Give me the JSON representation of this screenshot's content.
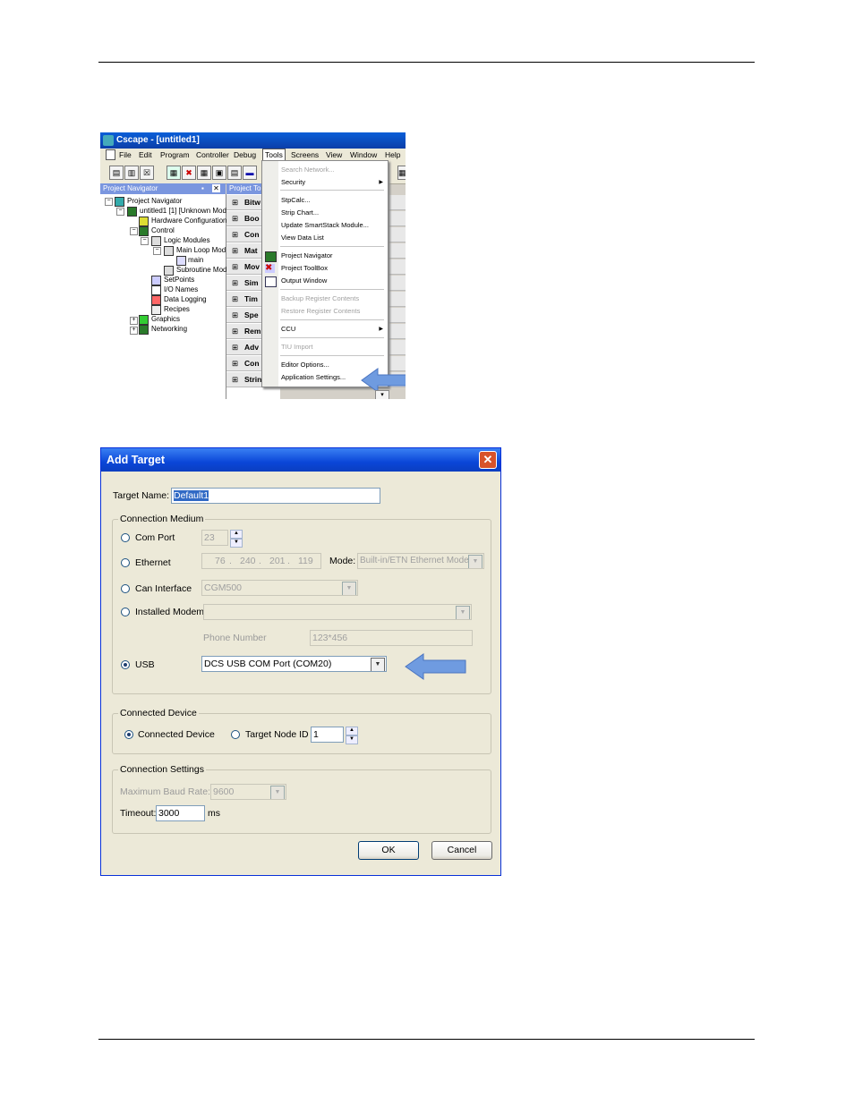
{
  "screenshot1": {
    "title": "Cscape - [untitled1]",
    "menu": [
      "File",
      "Edit",
      "Program",
      "Controller",
      "Debug",
      "Tools",
      "Screens",
      "View",
      "Window",
      "Help"
    ],
    "active_menu": "Tools",
    "navigator_header": "Project Navigator",
    "toolbox_header": "Project To",
    "tree": [
      "Project Navigator",
      "untitled1 [1] [Unknown Mod",
      "Hardware Configuration",
      "Control",
      "Logic Modules",
      "Main Loop Mod",
      "main",
      "Subroutine Mod",
      "SetPoints",
      "I/O Names",
      "Data Logging",
      "Recipes",
      "Graphics",
      "Networking"
    ],
    "toolbox_rows": [
      "Bitw",
      "Boo",
      "Con",
      "Mat",
      "Mov",
      "Sim",
      "Tim",
      "Spe",
      "Rem",
      "Adv",
      "Con",
      "String Operations"
    ],
    "tools_menu": {
      "search_network": "Search Network...",
      "security": "Security",
      "stpcalc": "StpCalc...",
      "strip_chart": "Strip Chart...",
      "update_smartstack": "Update SmartStack Module...",
      "view_data_list": "View Data List",
      "project_navigator": "Project Navigator",
      "project_toolbox": "Project ToolBox",
      "output_window": "Output Window",
      "backup_register": "Backup Register Contents",
      "restore_register": "Restore Register Contents",
      "ccu": "CCU",
      "tiu_import": "TIU Import",
      "editor_options": "Editor Options...",
      "application_settings": "Application Settings..."
    }
  },
  "dialog": {
    "title": "Add Target",
    "close": "✕",
    "target_name_label": "Target Name:",
    "target_name_value": "Default1",
    "connection_medium": "Connection Medium",
    "com_port_label": "Com Port",
    "com_port_value": "23",
    "ethernet_label": "Ethernet",
    "ip": [
      "76",
      "240",
      "201",
      "119"
    ],
    "mode_label": "Mode:",
    "mode_value": "Built-in/ETN Ethernet Mode",
    "can_label": "Can Interface",
    "can_value": "CGM500",
    "modem_label": "Installed Modem",
    "modem_value": "",
    "phone_label": "Phone Number",
    "phone_value": "123*456",
    "usb_label": "USB",
    "usb_value": "DCS USB COM Port (COM20)",
    "connected_device_group": "Connected Device",
    "connected_device_label": "Connected Device",
    "target_node_label": "Target Node ID",
    "target_node_value": "1",
    "connection_settings": "Connection Settings",
    "baud_label": "Maximum Baud Rate:",
    "baud_value": "9600",
    "timeout_label": "Timeout:",
    "timeout_value": "3000",
    "timeout_unit": "ms",
    "ok": "OK",
    "cancel": "Cancel"
  },
  "colors": {
    "arrow": "#6f9be0",
    "titlebar": "#0a46d8",
    "selection": "#316ac5"
  }
}
